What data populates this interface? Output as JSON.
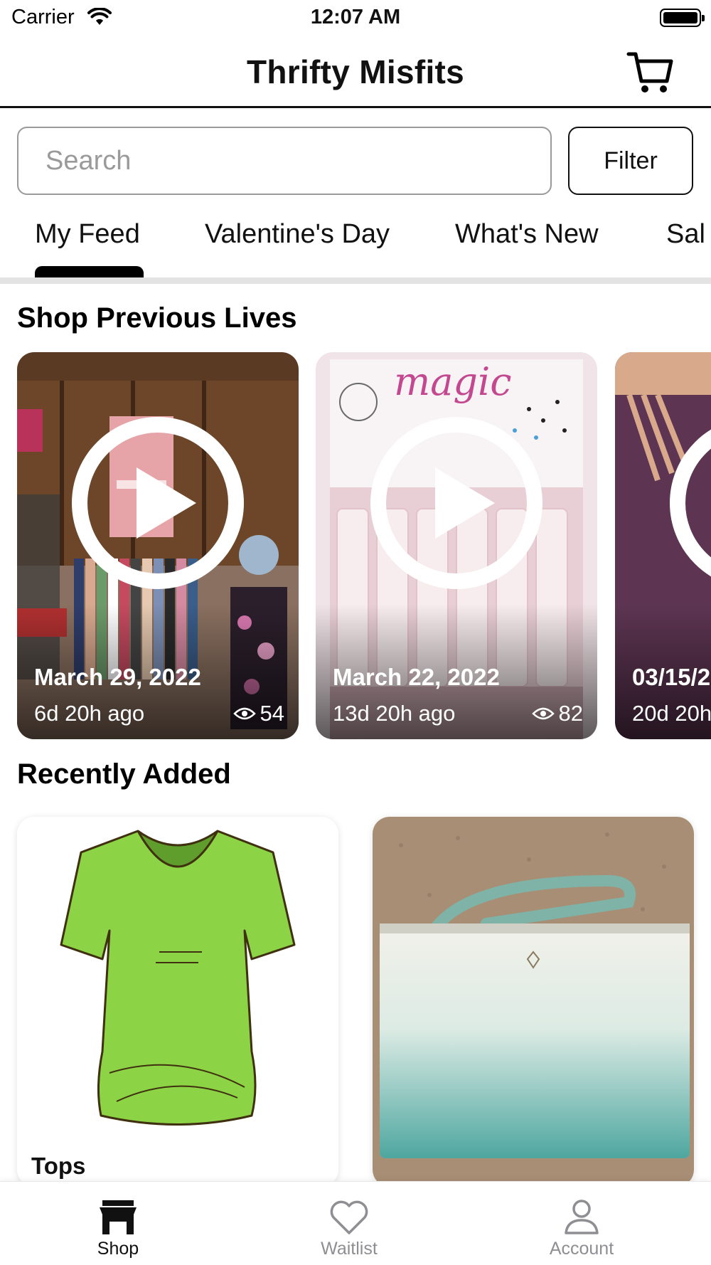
{
  "status_bar": {
    "carrier": "Carrier",
    "time": "12:07 AM"
  },
  "header": {
    "title": "Thrifty Misfits",
    "cart_icon": "cart-icon"
  },
  "search": {
    "placeholder": "Search",
    "value": "",
    "filter_label": "Filter"
  },
  "tabs": [
    {
      "label": "My Feed",
      "active": true
    },
    {
      "label": "Valentine's Day",
      "active": false
    },
    {
      "label": "What's New",
      "active": false
    },
    {
      "label": "Sal",
      "active": false
    }
  ],
  "previous_lives": {
    "title": "Shop Previous Lives",
    "items": [
      {
        "date": "March 29, 2022",
        "ago": "6d 20h ago",
        "views": "54"
      },
      {
        "date": "March 22, 2022",
        "ago": "13d 20h ago",
        "views": "82"
      },
      {
        "date": "03/15/2",
        "ago": "20d 20h",
        "views": ""
      }
    ]
  },
  "recently_added": {
    "title": "Recently Added",
    "items": [
      {
        "label": "Tops"
      },
      {
        "label": ""
      }
    ]
  },
  "tab_bar": {
    "items": [
      {
        "label": "Shop",
        "icon": "store-icon",
        "active": true
      },
      {
        "label": "Waitlist",
        "icon": "heart-icon",
        "active": false
      },
      {
        "label": "Account",
        "icon": "person-icon",
        "active": false
      }
    ]
  },
  "colors": {
    "accent": "#111111",
    "inactive": "#8e8e93",
    "divider": "#e3e3e3"
  }
}
